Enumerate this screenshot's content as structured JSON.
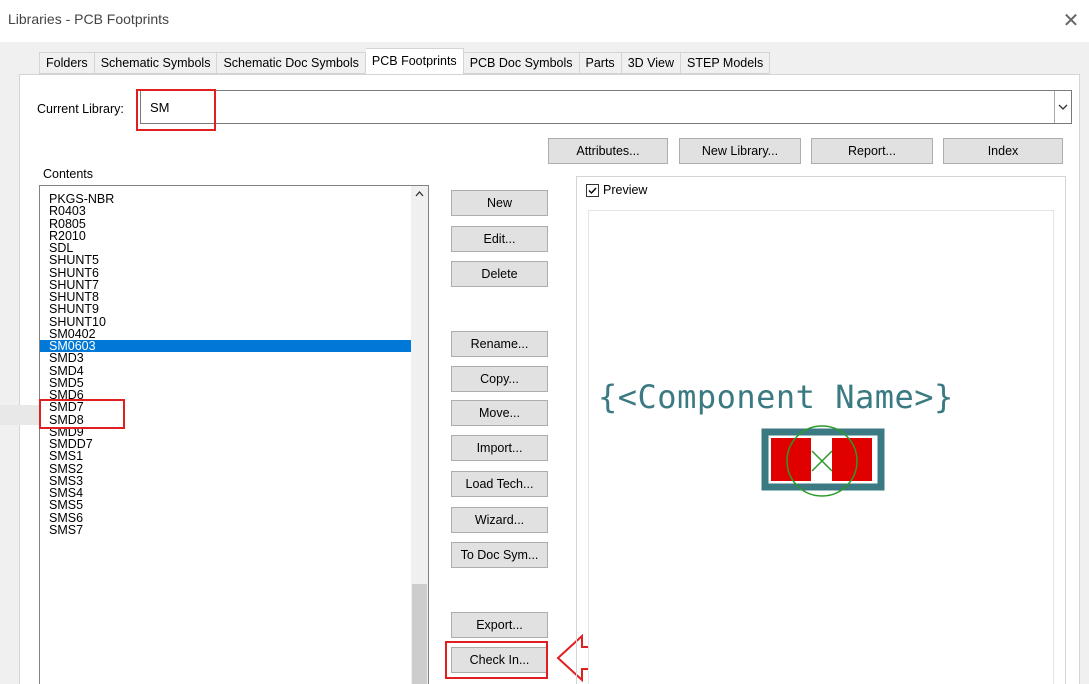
{
  "window": {
    "title": "Libraries - PCB Footprints",
    "close_glyph": "✕"
  },
  "tabs": [
    {
      "label": "Folders"
    },
    {
      "label": "Schematic Symbols"
    },
    {
      "label": "Schematic Doc Symbols"
    },
    {
      "label": "PCB Footprints",
      "active": true
    },
    {
      "label": "PCB Doc Symbols"
    },
    {
      "label": "Parts"
    },
    {
      "label": "3D View"
    },
    {
      "label": "STEP Models"
    }
  ],
  "current_library": {
    "label": "Current Library:",
    "value": "SM",
    "dropdown_icon": "chevron-down-icon"
  },
  "top_buttons": {
    "attributes": "Attributes...",
    "new_library": "New Library...",
    "report": "Report...",
    "index": "Index"
  },
  "contents": {
    "label": "Contents",
    "items": [
      "PKGS-NBR",
      "R0403",
      "R0805",
      "R2010",
      "SDL",
      "SHUNT5",
      "SHUNT6",
      "SHUNT7",
      "SHUNT8",
      "SHUNT9",
      "SHUNT10",
      "SM0402",
      "SM0603",
      "SMD3",
      "SMD4",
      "SMD5",
      "SMD6",
      "SMD7",
      "SMD8",
      "SMD9",
      "SMDD7",
      "SMS1",
      "SMS2",
      "SMS3",
      "SMS4",
      "SMS5",
      "SMS6",
      "SMS7"
    ],
    "selected": "SM0603"
  },
  "action_buttons": {
    "new": "New",
    "edit": "Edit...",
    "delete": "Delete",
    "rename": "Rename...",
    "copy": "Copy...",
    "move": "Move...",
    "import": "Import...",
    "load_tech": "Load Tech...",
    "wizard": "Wizard...",
    "to_doc_sym": "To Doc Sym...",
    "export": "Export...",
    "check_in": "Check In..."
  },
  "preview": {
    "checkbox_label": "Preview",
    "checked": true,
    "component_name": "{<Component Name>}"
  },
  "colors": {
    "selection": "#0078d7",
    "highlight": "#e02020",
    "footprint_outline": "#3b7a82",
    "pad": "#e00000",
    "circle": "#2a9a2a"
  }
}
